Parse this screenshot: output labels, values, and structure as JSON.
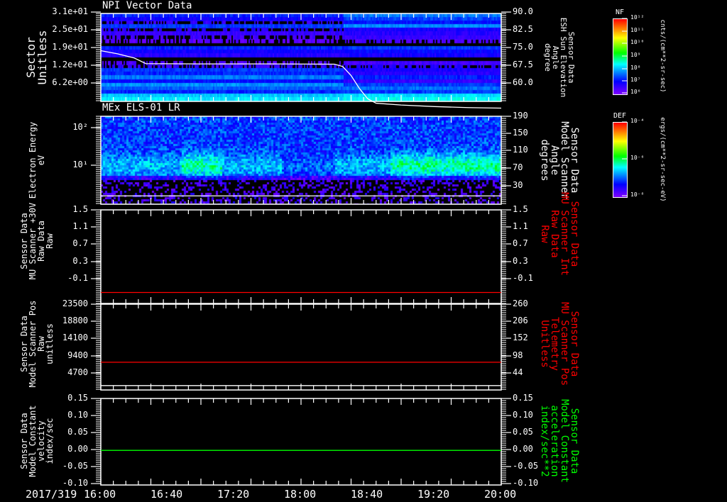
{
  "x_axis": {
    "date": "2017/319",
    "ticks": [
      "16:00",
      "16:40",
      "17:20",
      "18:00",
      "18:40",
      "19:20",
      "20:00"
    ]
  },
  "panels": [
    {
      "title": "NPI Vector Data",
      "left_label": [
        "Sector",
        "Unitless"
      ],
      "left_ticks": [
        "3.1e+01",
        "2.5e+01",
        "1.9e+01",
        "1.2e+01",
        "6.2e+00"
      ],
      "right_label": [
        "Sensor Data",
        "ESH Sun Elevation",
        "Angle",
        "degree"
      ],
      "right_ticks": [
        "90.0",
        "82.5",
        "75.0",
        "67.5",
        "60.0"
      ],
      "right_color": "#ffffff"
    },
    {
      "title": "MEx ELS-01 LR",
      "left_label": [
        "Electron Energy",
        "eV"
      ],
      "left_ticks": [
        "10²",
        "10¹"
      ],
      "right_label": [
        "Sensor Data",
        "Model Scanner",
        "Angle",
        "degrees"
      ],
      "right_ticks": [
        "190",
        "150",
        "110",
        "70",
        "30"
      ],
      "right_color": "#ffffff"
    },
    {
      "title": "",
      "left_label": [
        "Sensor Data",
        "MU Scanner +30V",
        "Raw Data",
        "Raw"
      ],
      "left_ticks": [
        "1.5",
        "1.1",
        "0.7",
        "0.3",
        "-0.1"
      ],
      "right_label": [
        "Sensor Data",
        "MU Scanner Int",
        "Raw Data",
        "Raw"
      ],
      "right_ticks": [
        "1.5",
        "1.1",
        "0.7",
        "0.3",
        "-0.1"
      ],
      "right_color": "#ff0000"
    },
    {
      "title": "",
      "left_label": [
        "Sensor Data",
        "Model Scanner Pos",
        "Raw",
        "unitless"
      ],
      "left_ticks": [
        "23500",
        "18800",
        "14100",
        "9400",
        "4700"
      ],
      "right_label": [
        "Sensor Data",
        "MU Scanner Pos",
        "Telemetry",
        "Unitless"
      ],
      "right_ticks": [
        "260",
        "206",
        "152",
        "98",
        "44"
      ],
      "right_color": "#ff0000"
    },
    {
      "title": "",
      "left_label": [
        "Sensor Data",
        "Model Constant",
        "velocity",
        "index/sec"
      ],
      "left_ticks": [
        "0.15",
        "0.10",
        "0.05",
        "0.00",
        "-0.05",
        "-0.10"
      ],
      "right_label": [
        "Sensor Data",
        "Model Constant",
        "acceleration",
        "index/sec**2"
      ],
      "right_ticks": [
        "0.15",
        "0.10",
        "0.05",
        "0.00",
        "-0.05",
        "-0.10"
      ],
      "right_color": "#00ff00"
    }
  ],
  "colorbars": [
    {
      "label": "NF",
      "ticks": [
        "10¹²",
        "10¹¹",
        "10¹⁰",
        "10⁹",
        "10⁸",
        "10⁷",
        "10⁶"
      ],
      "units": "cnts/(cm**2-sr-sec)"
    },
    {
      "label": "DEF",
      "ticks": [
        "10⁻⁴",
        "10⁻⁶",
        "10⁻⁸"
      ],
      "units": "ergs/(cm**2-sr-sec-eV)"
    }
  ],
  "chart_data": [
    {
      "type": "heatmap",
      "title": "NPI Vector Data",
      "ylabel": "Sector Unitless",
      "xlim": [
        "16:00",
        "20:00"
      ],
      "ylim": [
        0,
        31
      ],
      "colorbar": {
        "label": "NF",
        "range": [
          1000000.0,
          1000000000000.0
        ],
        "scale": "log",
        "colormap": "rainbow"
      },
      "overlay_line": {
        "name": "Sensor Data ESH Sun Elevation Angle",
        "units": "degree",
        "axis": "right",
        "ylim": [
          56,
          90
        ],
        "color": "#ffffff",
        "x": [
          "16:00",
          "16:10",
          "16:20",
          "16:27",
          "17:00",
          "17:40",
          "18:20",
          "18:25",
          "18:30",
          "18:35",
          "18:40",
          "18:45",
          "19:00",
          "19:20",
          "19:40",
          "20:00"
        ],
        "y": [
          75.6,
          74.4,
          72.8,
          70.6,
          70.5,
          70.5,
          70.4,
          69.5,
          66.0,
          61.0,
          57.0,
          55.3,
          54.6,
          54.0,
          53.6,
          53.4
        ]
      }
    },
    {
      "type": "heatmap",
      "title": "MEx ELS-01 LR",
      "ylabel": "Electron Energy eV",
      "yscale": "log",
      "xlim": [
        "16:00",
        "20:00"
      ],
      "colorbar": {
        "label": "DEF",
        "scale": "log",
        "colormap": "rainbow"
      },
      "overlay_line": {
        "name": "Sensor Data Model Scanner Angle",
        "units": "degrees",
        "axis": "right",
        "ylim": [
          -10,
          190
        ],
        "color": "#ffffff",
        "x": [
          "16:00",
          "20:00"
        ],
        "y": [
          9,
          9
        ]
      }
    },
    {
      "type": "line",
      "xlim": [
        "16:00",
        "20:00"
      ],
      "ylim": [
        -0.2,
        1.5
      ],
      "series": [
        {
          "name": "Sensor Data MU Scanner Int Raw Data",
          "color": "#ff0000",
          "x": [
            "16:00",
            "20:00"
          ],
          "y": [
            0.0,
            0.0
          ]
        }
      ]
    },
    {
      "type": "line",
      "xlim": [
        "16:00",
        "20:00"
      ],
      "series": [
        {
          "name": "Sensor Data Model Scanner Pos",
          "axis": "left",
          "ylim": [
            0,
            23500
          ],
          "color": "#ffffff",
          "x": [
            "16:00",
            "20:00"
          ],
          "y": [
            1200,
            1200
          ]
        },
        {
          "name": "Sensor Data MU Scanner Pos Telemetry",
          "axis": "right",
          "ylim": [
            0,
            260
          ],
          "color": "#ff0000",
          "x": [
            "16:00",
            "20:00"
          ],
          "y": [
            84,
            84
          ]
        }
      ]
    },
    {
      "type": "line",
      "xlim": [
        "16:00",
        "20:00"
      ],
      "ylim": [
        -0.1,
        0.15
      ],
      "series": [
        {
          "name": "Sensor Data Model Constant acceleration",
          "color": "#00ff00",
          "x": [
            "16:00",
            "20:00"
          ],
          "y": [
            0.0,
            0.0
          ]
        }
      ]
    }
  ]
}
